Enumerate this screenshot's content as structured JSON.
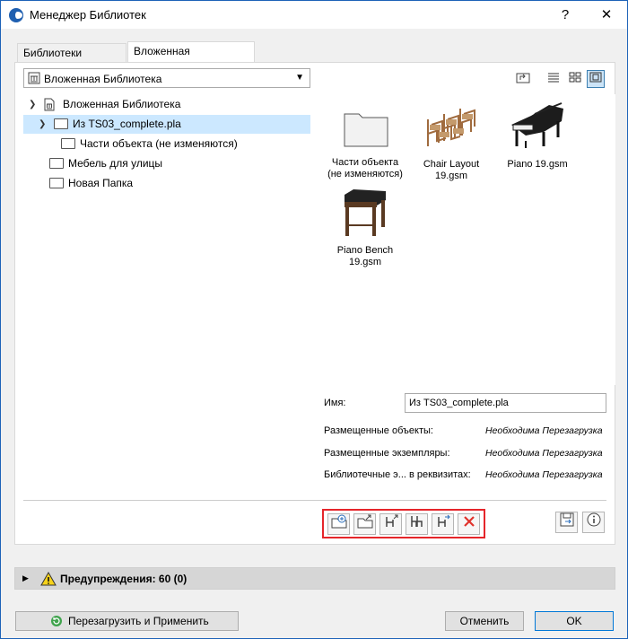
{
  "window": {
    "title": "Менеджер Библиотек",
    "help": "?",
    "close": "✕"
  },
  "tabs": [
    {
      "label": "Библиотеки Проекта"
    },
    {
      "label": "Вложенная Библиотека"
    }
  ],
  "dropdown": {
    "value": "Вложенная Библиотека"
  },
  "tree": [
    {
      "label": "Вложенная Библиотека"
    },
    {
      "label": "Из TS03_complete.pla"
    },
    {
      "label": "Части объекта (не изменяются)"
    },
    {
      "label": "Мебель для улицы"
    },
    {
      "label": "Новая Папка"
    }
  ],
  "items": [
    {
      "label": "Части объекта\n(не изменяются)"
    },
    {
      "label": "Chair Layout\n19.gsm"
    },
    {
      "label": "Piano 19.gsm"
    },
    {
      "label": "Piano Bench\n19.gsm"
    }
  ],
  "props": {
    "name_label": "Имя:",
    "name_value": "Из TS03_complete.pla",
    "rows": [
      {
        "label": "Размещенные объекты:",
        "value": "Необходима Перезагрузка"
      },
      {
        "label": "Размещенные экземпляры:",
        "value": "Необходима Перезагрузка"
      },
      {
        "label": "Библиотечные э... в реквизитах:",
        "value": "Необходима Перезагрузка"
      }
    ]
  },
  "warnings": {
    "label": "Предупреждения: 60 (0)"
  },
  "buttons": {
    "reload": "Перезагрузить и Применить",
    "cancel": "Отменить",
    "ok": "OK"
  },
  "colors": {
    "selection": "#cce8ff",
    "highlight_border": "#e5252a",
    "delete": "#e0332c"
  }
}
